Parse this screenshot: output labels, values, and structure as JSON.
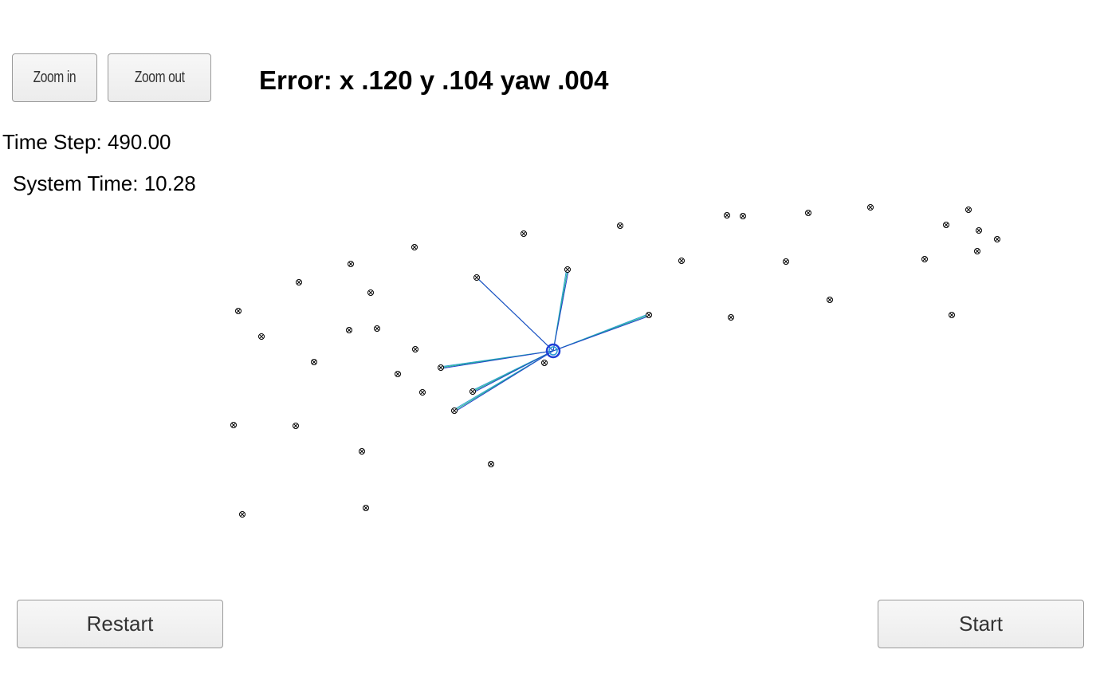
{
  "toolbar": {
    "zoom_in_label": "Zoom in",
    "zoom_out_label": "Zoom out"
  },
  "status": {
    "error_text": "Error: x .120 y .104 yaw .004",
    "time_step_text": "Time Step: 490.00",
    "system_time_text": "System Time: 10.28"
  },
  "controls": {
    "restart_label": "Restart",
    "start_label": "Start"
  },
  "colors": {
    "landmark": "#000000",
    "vehicle": "#1f3fd6",
    "observation_a": "#2a9bd6",
    "observation_b": "#1fb88a",
    "observation_c": "#2244cc"
  }
}
